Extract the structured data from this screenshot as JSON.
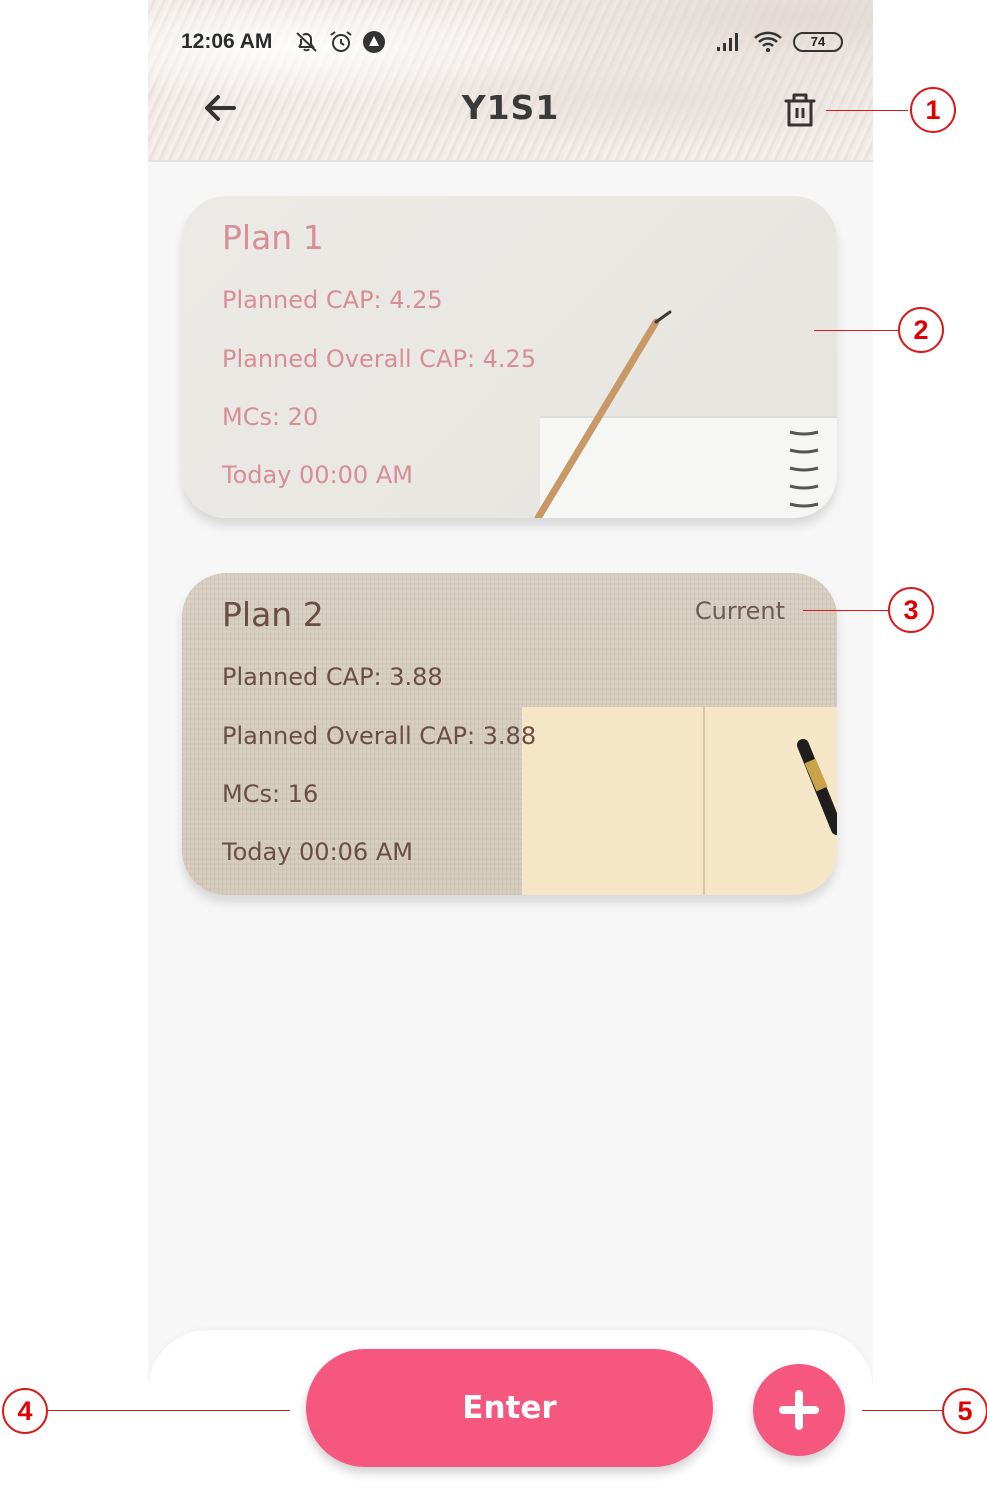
{
  "status_bar": {
    "time": "12:06 AM",
    "battery": "74",
    "left_icons": [
      "mute-icon",
      "alarm-icon",
      "app-notification-icon"
    ],
    "right_icons": [
      "signal-icon",
      "wifi-icon",
      "battery-icon"
    ]
  },
  "toolbar": {
    "title": "Y1S1",
    "back_icon": "arrow-left-icon",
    "delete_icon": "trash-icon"
  },
  "plans": [
    {
      "title": "Plan 1",
      "planned_cap": "Planned CAP: 4.25",
      "planned_overall_cap": "Planned Overall CAP: 4.25",
      "mcs": "MCs: 20",
      "timestamp": "Today 00:00 AM",
      "text_color": "#d88e96"
    },
    {
      "title": "Plan 2",
      "tag": "Current",
      "planned_cap": "Planned CAP: 3.88",
      "planned_overall_cap": "Planned Overall CAP: 3.88",
      "mcs": "MCs: 16",
      "timestamp": "Today 00:06 AM",
      "text_color": "#6a4e46"
    }
  ],
  "bottom_bar": {
    "enter_label": "Enter",
    "add_icon": "plus-icon",
    "accent_color": "#f5577f"
  },
  "annotations": [
    "1",
    "2",
    "3",
    "4",
    "5"
  ]
}
